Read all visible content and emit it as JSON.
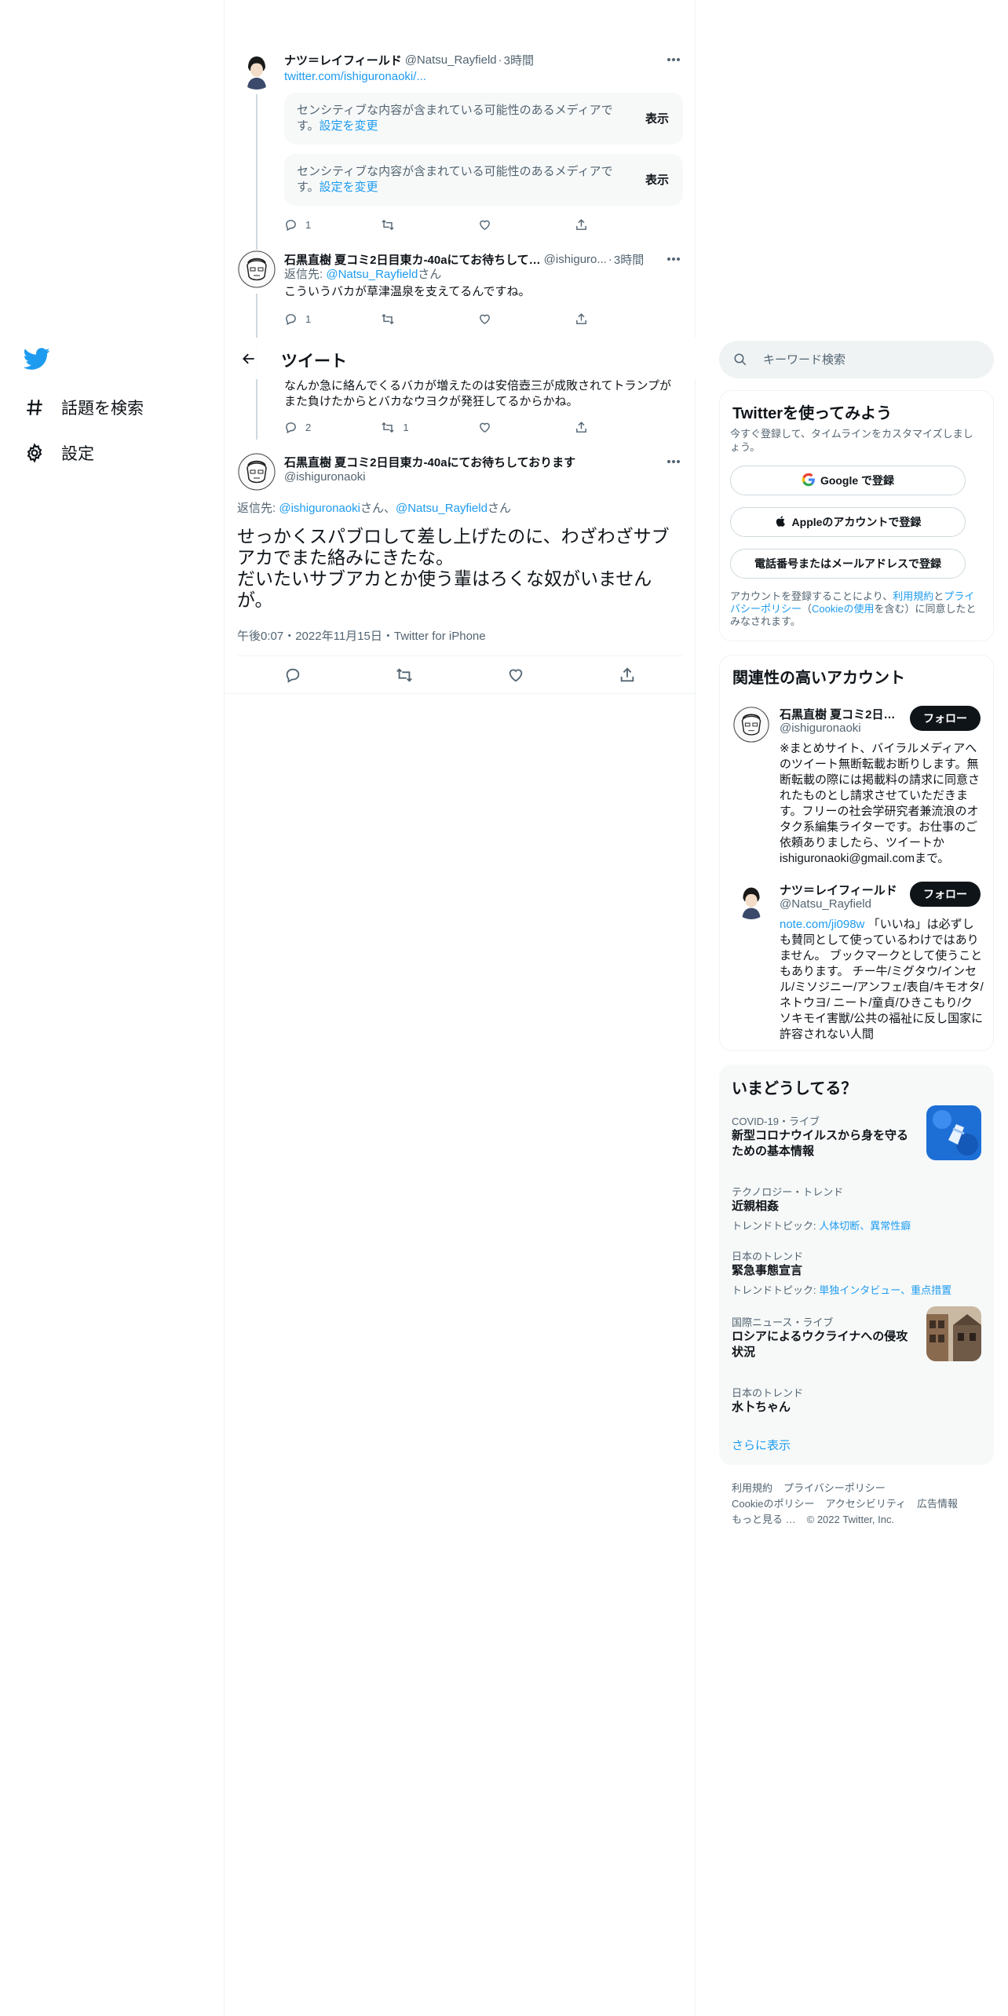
{
  "nav": {
    "explore_label": "話題を検索",
    "settings_label": "設定"
  },
  "header": {
    "title": "ツイート"
  },
  "tweets": [
    {
      "name": "ナツ＝レイフィールド",
      "handle": "@Natsu_Rayfield",
      "time": "3時間",
      "link": "twitter.com/ishiguronaoki/...",
      "sensitive_msg": "センシティブな内容が含まれている可能性のあるメディアです。",
      "sensitive_link": "設定を変更",
      "show_label": "表示",
      "reply_count": "1",
      "retweet_count": "",
      "like_count": ""
    },
    {
      "name": "石黒直樹 夏コミ2日目東カ-40aにてお待ちして…",
      "handle": "@ishiguro...",
      "time": "3時間",
      "reply_to_prefix": "返信先: ",
      "reply_to_handle": "@Natsu_Rayfield",
      "reply_to_suffix": "さん",
      "text": "こういうバカが草津温泉を支えてるんですね。",
      "reply_count": "1",
      "retweet_count": "",
      "like_count": ""
    },
    {
      "text": "なんか急に絡んでくるバカが増えたのは安倍壺三が成敗されてトランプがまた負けたからとバカなウヨクが発狂してるからかね。",
      "reply_count": "2",
      "retweet_count": "1",
      "like_count": ""
    }
  ],
  "focused": {
    "name": "石黒直樹 夏コミ2日目東カ-40aにてお待ちしております",
    "handle": "@ishiguronaoki",
    "reply_to_prefix": "返信先: ",
    "reply_to_handle1": "@ishiguronaoki",
    "reply_to_mid": "さん、",
    "reply_to_handle2": "@Natsu_Rayfield",
    "reply_to_suffix": "さん",
    "text": "せっかくスパブロして差し上げたのに、わざわざサブアカでまた絡みにきたな。\nだいたいサブアカとか使う輩はろくな奴がいませんが。",
    "time": "午後0:07",
    "date": "2022年11月15日",
    "source": "Twitter for iPhone",
    "sep": "・"
  },
  "search": {
    "placeholder": "キーワード検索"
  },
  "signup": {
    "title": "Twitterを使ってみよう",
    "desc": "今すぐ登録して、タイムラインをカスタマイズしましょう。",
    "google": "Google で登録",
    "apple": "Appleのアカウントで登録",
    "phone": "電話番号またはメールアドレスで登録",
    "terms_pre": "アカウントを登録することにより、",
    "terms_link1": "利用規約",
    "terms_and": "と",
    "terms_link2": "プライバシーポリシー",
    "terms_paren_open": "（",
    "terms_link3": "Cookieの使用",
    "terms_post": "を含む）に同意したとみなされます。"
  },
  "related": {
    "title": "関連性の高いアカウント",
    "follow_label": "フォロー",
    "accounts": [
      {
        "name": "石黒直樹 夏コミ2日…",
        "handle": "@ishiguronaoki",
        "bio": "※まとめサイト、バイラルメディアへのツイート無断転載お断りします。無断転載の際には掲載料の請求に同意されたものとし請求させていただきます。フリーの社会学研究者兼流浪のオタク系編集ライターです。お仕事のご依頼ありましたら、ツイートかishiguronaoki@gmail.comまで。"
      },
      {
        "name": "ナツ＝レイフィールド",
        "handle": "@Natsu_Rayfield",
        "bio_link": "note.com/ji098w",
        "bio": "「いいね」は必ずしも賛同として使っているわけではありません。 ブックマークとして使うこともあります。 チー牛/ミグタウ/インセル/ミソジニー/アンフェ/表自/キモオタ/ネトウヨ/ ニート/童貞/ひきこもり/クソキモイ害獣/公共の福祉に反し国家に許容されない人間"
      }
    ]
  },
  "trends": {
    "title": "いまどうしてる？",
    "items": [
      {
        "meta": "COVID-19・ライブ",
        "title": "新型コロナウイルスから身を守るための基本情報",
        "topics_label": "",
        "topics": ""
      },
      {
        "meta": "テクノロジー・トレンド",
        "title": "近親相姦",
        "topics_label": "トレンドトピック: ",
        "topics": "人体切断、異常性癖"
      },
      {
        "meta": "日本のトレンド",
        "title": "緊急事態宣言",
        "topics_label": "トレンドトピック: ",
        "topics": "単独インタビュー、重点措置"
      },
      {
        "meta": "国際ニュース・ライブ",
        "title": "ロシアによるウクライナへの侵攻状況",
        "topics_label": "",
        "topics": ""
      },
      {
        "meta": "日本のトレンド",
        "title": "水卜ちゃん",
        "topics_label": "",
        "topics": ""
      }
    ],
    "show_more": "さらに表示"
  },
  "footer": {
    "terms": "利用規約",
    "privacy": "プライバシーポリシー",
    "cookie": "Cookieのポリシー",
    "accessibility": "アクセシビリティ",
    "ads": "広告情報",
    "more": "もっと見る …",
    "copyright": "© 2022 Twitter, Inc."
  },
  "colors": {
    "accent": "#1d9bf0",
    "text": "#0f1419",
    "muted": "#536471",
    "border": "#eff3f4"
  }
}
